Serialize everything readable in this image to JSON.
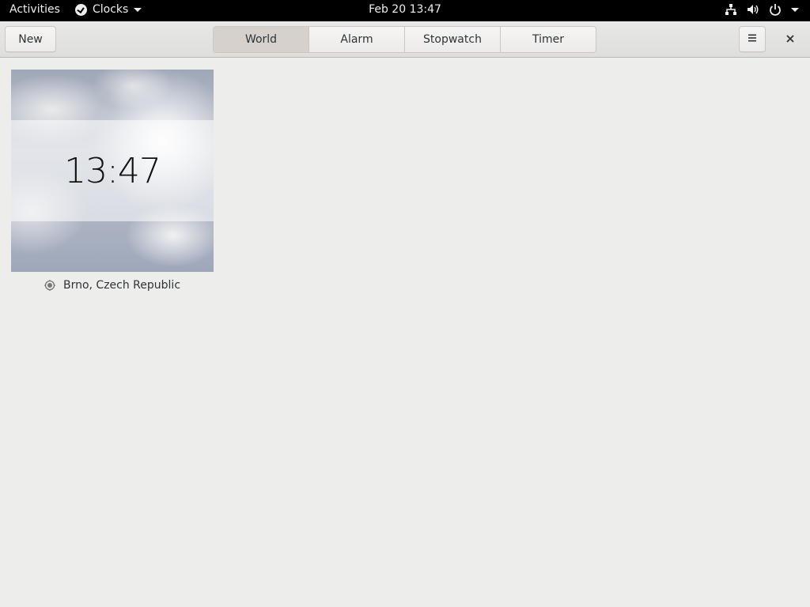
{
  "topbar": {
    "activities": "Activities",
    "app_name": "Clocks",
    "datetime": "Feb 20  13:47",
    "icons": [
      "network-icon",
      "volume-icon",
      "power-icon",
      "chevron-down-icon"
    ]
  },
  "header": {
    "new_label": "New",
    "tabs": [
      {
        "label": "World",
        "active": true
      },
      {
        "label": "Alarm",
        "active": false
      },
      {
        "label": "Stopwatch",
        "active": false
      },
      {
        "label": "Timer",
        "active": false
      }
    ],
    "menu_icon": "hamburger-menu-icon",
    "close_icon": "close-icon"
  },
  "world": {
    "clocks": [
      {
        "time": "13:47",
        "location": "Brno, Czech Republic",
        "location_icon": "current-location-icon"
      }
    ]
  },
  "colors": {
    "topbar_bg": "#000000",
    "window_bg": "#ededeb",
    "active_tab": "#d6d1cd"
  }
}
